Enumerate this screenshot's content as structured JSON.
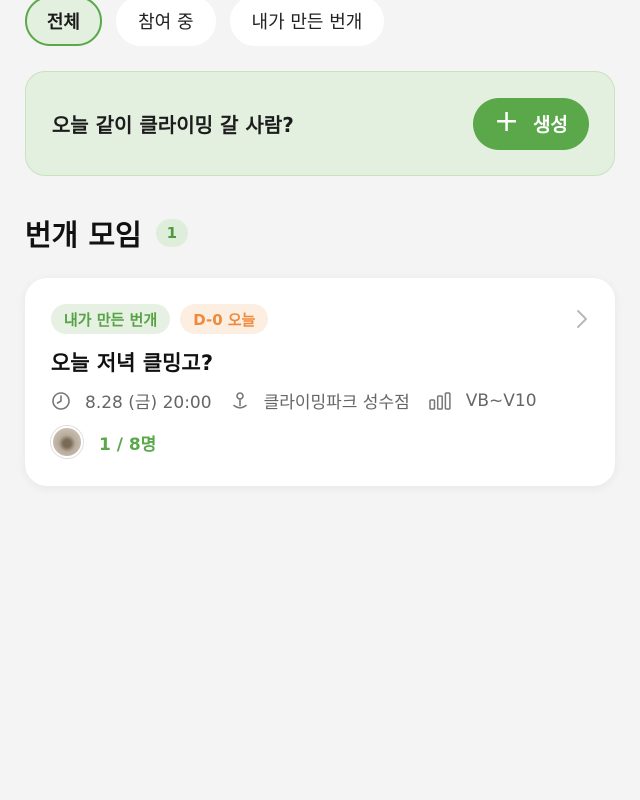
{
  "filters": [
    {
      "label": "전체",
      "active": true
    },
    {
      "label": "참여 중",
      "active": false
    },
    {
      "label": "내가 만든 번개",
      "active": false
    }
  ],
  "banner": {
    "text": "오늘 같이 클라이밍 갈 사람?",
    "create_label": "생성",
    "create_icon": "plus-icon"
  },
  "section": {
    "title": "번개 모임",
    "count": "1"
  },
  "meetups": [
    {
      "tags": [
        "내가 만든 번개",
        "D-0 오늘"
      ],
      "title": "오늘 저녁 클밍고?",
      "datetime": "8.28 (금) 20:00",
      "place": "클라이밍파크 성수점",
      "level": "VB~V10",
      "members": "1 / 8명"
    }
  ],
  "colors": {
    "accent": "#5aa84a",
    "accent_bg": "#e3efdf",
    "dday": "#ef8a3c"
  }
}
